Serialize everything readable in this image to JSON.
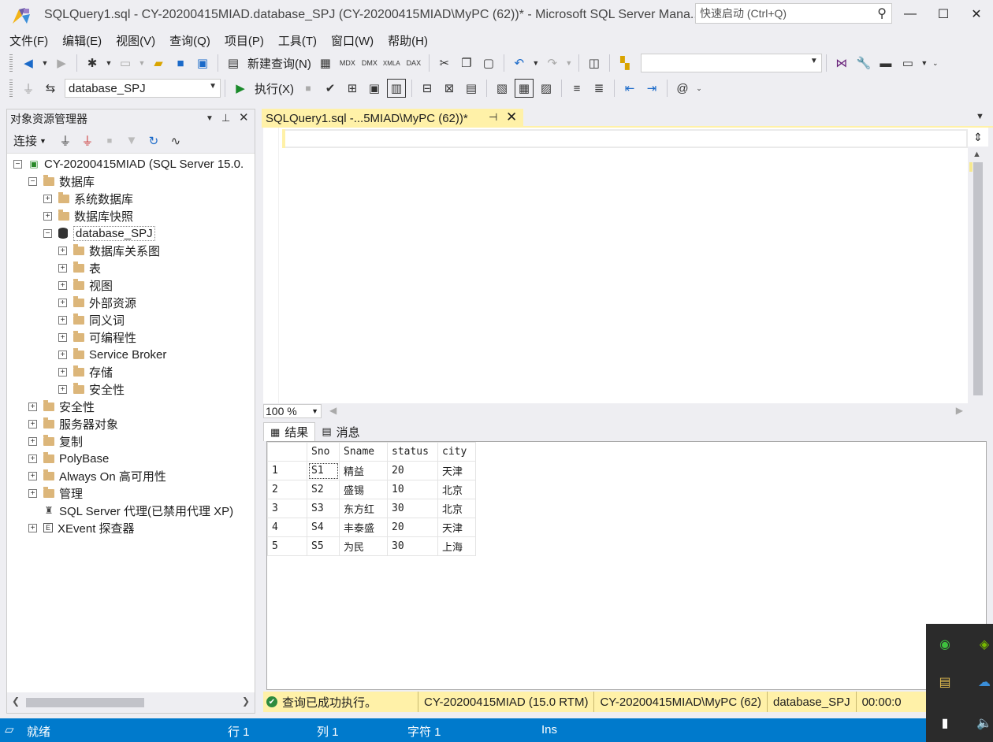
{
  "window": {
    "title": "SQLQuery1.sql - CY-20200415MIAD.database_SPJ (CY-20200415MIAD\\MyPC (62))* - Microsoft SQL Server Mana...",
    "quick_launch_placeholder": "快速启动 (Ctrl+Q)",
    "minimize": "—",
    "maximize": "☐",
    "close": "✕"
  },
  "menu": [
    "文件(F)",
    "编辑(E)",
    "视图(V)",
    "查询(Q)",
    "项目(P)",
    "工具(T)",
    "窗口(W)",
    "帮助(H)"
  ],
  "toolbar": {
    "new_query_label": "新建查询(N)",
    "database_combo": "database_SPJ",
    "execute_label": "执行(X)",
    "solution_combo": ""
  },
  "object_explorer": {
    "title": "对象资源管理器",
    "connect_label": "连接",
    "tree": [
      {
        "label": "CY-20200415MIAD (SQL Server 15.0.",
        "expander": "−",
        "icon": "server"
      },
      {
        "label": "数据库",
        "expander": "−",
        "icon": "folder"
      },
      {
        "label": "系统数据库",
        "expander": "+",
        "icon": "folder"
      },
      {
        "label": "数据库快照",
        "expander": "+",
        "icon": "folder"
      },
      {
        "label": "database_SPJ",
        "expander": "−",
        "icon": "database"
      },
      {
        "label": "数据库关系图",
        "expander": "+",
        "icon": "folder"
      },
      {
        "label": "表",
        "expander": "+",
        "icon": "folder"
      },
      {
        "label": "视图",
        "expander": "+",
        "icon": "folder"
      },
      {
        "label": "外部资源",
        "expander": "+",
        "icon": "folder"
      },
      {
        "label": "同义词",
        "expander": "+",
        "icon": "folder"
      },
      {
        "label": "可编程性",
        "expander": "+",
        "icon": "folder"
      },
      {
        "label": "Service Broker",
        "expander": "+",
        "icon": "folder"
      },
      {
        "label": "存储",
        "expander": "+",
        "icon": "folder"
      },
      {
        "label": "安全性",
        "expander": "+",
        "icon": "folder"
      },
      {
        "label": "安全性",
        "expander": "+",
        "icon": "folder"
      },
      {
        "label": "服务器对象",
        "expander": "+",
        "icon": "folder"
      },
      {
        "label": "复制",
        "expander": "+",
        "icon": "folder"
      },
      {
        "label": "PolyBase",
        "expander": "+",
        "icon": "folder"
      },
      {
        "label": "Always On 高可用性",
        "expander": "+",
        "icon": "folder"
      },
      {
        "label": "管理",
        "expander": "+",
        "icon": "folder"
      },
      {
        "label": "SQL Server 代理(已禁用代理 XP)",
        "expander": "",
        "icon": "agent"
      },
      {
        "label": "XEvent 探查器",
        "expander": "+",
        "icon": "xevent"
      }
    ]
  },
  "editor": {
    "tab_title": "SQLQuery1.sql -...5MIAD\\MyPC (62))*",
    "zoom": "100 %"
  },
  "results": {
    "tab_results": "结果",
    "tab_messages": "消息",
    "columns": [
      "Sno",
      "Sname",
      "status",
      "city"
    ],
    "rows": [
      [
        "1",
        "S1",
        "精益",
        "20",
        "天津"
      ],
      [
        "2",
        "S2",
        "盛锡",
        "10",
        "北京"
      ],
      [
        "3",
        "S3",
        "东方红",
        "30",
        "北京"
      ],
      [
        "4",
        "S4",
        "丰泰盛",
        "20",
        "天津"
      ],
      [
        "5",
        "S5",
        "为民",
        "30",
        "上海"
      ]
    ]
  },
  "query_status": {
    "message": "查询已成功执行。",
    "server": "CY-20200415MIAD (15.0 RTM)",
    "user": "CY-20200415MIAD\\MyPC (62)",
    "database": "database_SPJ",
    "elapsed": "00:00:0"
  },
  "statusbar": {
    "ready": "就绪",
    "line": "行 1",
    "col": "列 1",
    "char": "字符 1",
    "mode": "Ins"
  }
}
